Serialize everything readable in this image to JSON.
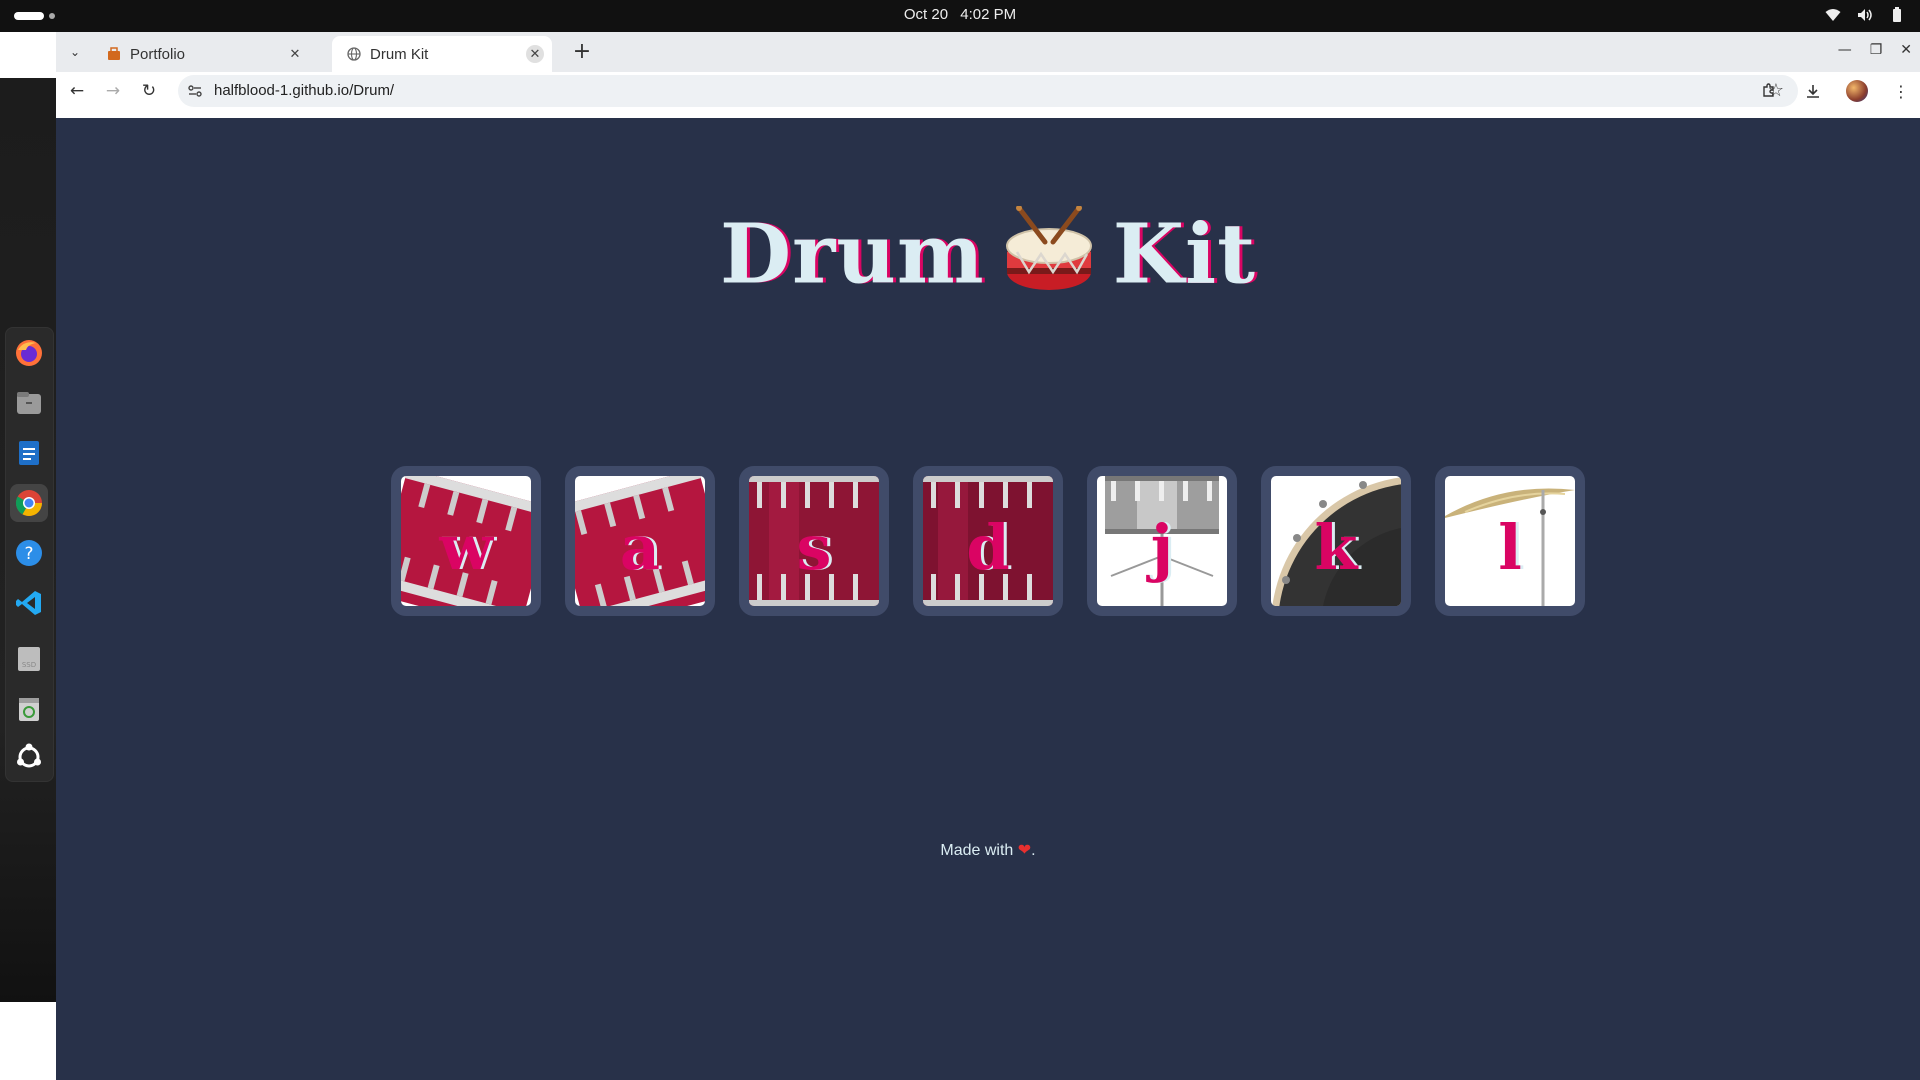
{
  "system_bar": {
    "date": "Oct 20",
    "time": "4:02 PM"
  },
  "dock": {
    "apps": [
      "firefox-icon",
      "files-icon",
      "writer-icon",
      "chrome-icon",
      "help-icon",
      "vscode-icon",
      "ssd-icon",
      "trash-icon",
      "ubuntu-icon"
    ]
  },
  "browser": {
    "tabs": [
      {
        "title": "Portfolio",
        "active": false
      },
      {
        "title": "Drum Kit",
        "active": true
      }
    ],
    "url": "halfblood-1.github.io/Drum/"
  },
  "page": {
    "title_left": "Drum",
    "title_right": "Kit",
    "drums": [
      {
        "key": "w"
      },
      {
        "key": "a"
      },
      {
        "key": "s"
      },
      {
        "key": "d"
      },
      {
        "key": "j"
      },
      {
        "key": "k"
      },
      {
        "key": "l"
      }
    ],
    "footer_text": "Made with",
    "footer_end": "."
  },
  "colors": {
    "page_bg": "#283149",
    "tile_border": "#404b69",
    "key_color": "#da0463",
    "title_color": "#dbedf3"
  }
}
